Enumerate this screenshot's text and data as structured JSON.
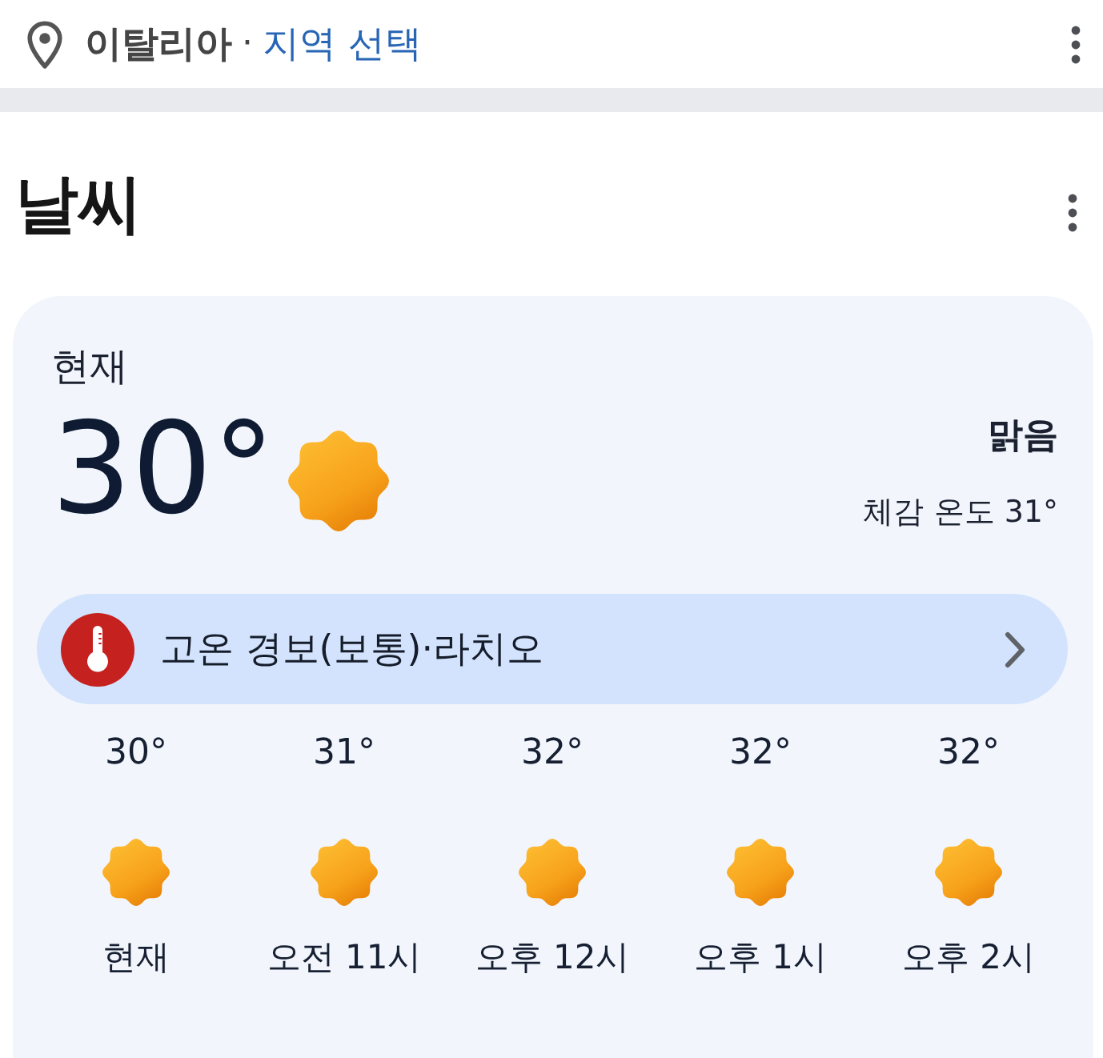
{
  "location_bar": {
    "location": "이탈리아",
    "separator": "·",
    "action": "지역 선택"
  },
  "section": {
    "title": "날씨"
  },
  "current": {
    "label": "현재",
    "temperature": "30°",
    "kind": "sunny",
    "condition": "맑음",
    "feels_like": "체감 온도 31°"
  },
  "alert": {
    "title": "고온 경보(보통)·라치오"
  },
  "hourly": [
    {
      "temperature": "30°",
      "kind": "sunny",
      "time": "현재"
    },
    {
      "temperature": "31°",
      "kind": "sunny",
      "time": "오전 11시"
    },
    {
      "temperature": "32°",
      "kind": "sunny",
      "time": "오후 12시"
    },
    {
      "temperature": "32°",
      "kind": "sunny",
      "time": "오후 1시"
    },
    {
      "temperature": "32°",
      "kind": "sunny",
      "time": "오후 2시"
    }
  ]
}
